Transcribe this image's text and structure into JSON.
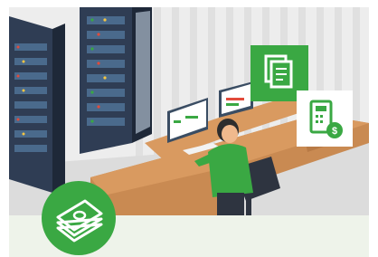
{
  "card": {
    "illustration_name": "finance-office-illustration",
    "badge_icon": "money-stack-icon",
    "doc_icon": "copy-documents-icon",
    "calc_icon": "calculator-dollar-icon"
  },
  "colors": {
    "accent_green": "#3aa843",
    "footer_bg": "#eef3ea",
    "wall_stripe": "#e2e2e2",
    "desk": "#c98a52",
    "server": "#2f3d54"
  }
}
